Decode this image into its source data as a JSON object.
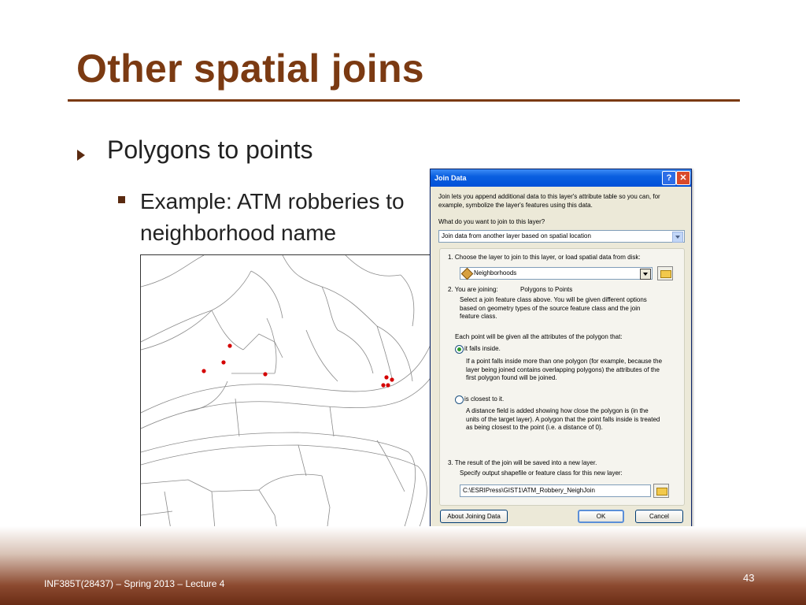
{
  "slide": {
    "title": "Other spatial joins",
    "bullet1": "Polygons to points",
    "bullet2": "Example: ATM robberies to neighborhood name",
    "footer": "INF385T(28437) – Spring 2013 – Lecture 4",
    "page_number": "43"
  },
  "dialog": {
    "title": "Join Data",
    "help_label": "?",
    "close_label": "✕",
    "intro": "Join lets you append additional data to this layer's attribute table so you can, for example, symbolize the layer's features using this data.",
    "question": "What do you want to join to this layer?",
    "join_type": "Join data from another layer based on spatial location",
    "step1": "1.  Choose the layer to join to this layer, or load spatial data from disk:",
    "layer_value": "Neighborhoods",
    "step2_label": "2.  You are joining:",
    "step2_value": "Polygons to Points",
    "step2_desc": "Select a join feature class above.  You will be given different options based on geometry types of the source feature class and the join feature class.",
    "each_point": "Each point will be given all the attributes of the polygon that:",
    "option1": "it falls inside.",
    "option1_desc": "If a point falls inside more than one polygon (for example, because the layer being joined contains overlapping polygons) the attributes of the first polygon found will be joined.",
    "option2": "is closest to it.",
    "option2_desc": "A distance field is added showing how close the polygon is (in the units of the target layer). A polygon that the point falls inside is treated as being closest to the point (i.e. a distance of 0).",
    "step3": "3.  The result of the join will be saved into a new layer.",
    "step3_desc": "Specify output shapefile or feature class for this new layer:",
    "output_path": "C:\\ESRIPress\\GIST1\\ATM_Robbery_NeighJoin",
    "about_button": "About Joining Data",
    "ok_button": "OK",
    "cancel_button": "Cancel"
  },
  "colors": {
    "title_brown": "#7b3a12",
    "point_red": "#d40000",
    "xp_blue": "#0a5fe0"
  }
}
